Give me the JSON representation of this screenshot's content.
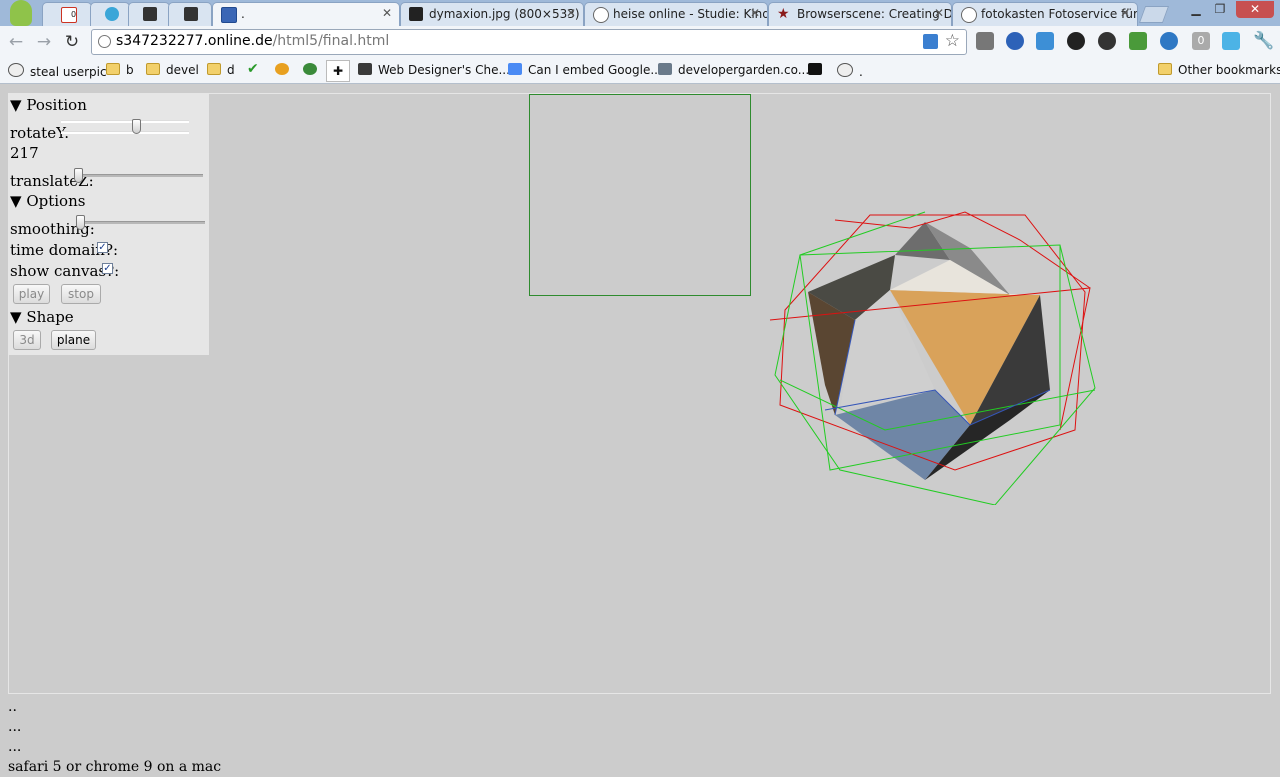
{
  "tabs": [
    {
      "title": "",
      "favicon": "gmail-icon",
      "color": "#cc3322",
      "badge": "0"
    },
    {
      "title": "",
      "favicon": "twitter-icon",
      "color": "#3aa6d8"
    },
    {
      "title": "",
      "favicon": "plus-app-icon",
      "color": "#333333"
    },
    {
      "title": "",
      "favicon": "plus-app-icon",
      "color": "#333333"
    },
    {
      "title": ".",
      "favicon": "page-icon",
      "color": "#3a66b5",
      "active": true
    },
    {
      "title": "dymaxion.jpg (800×533)",
      "favicon": "image-icon",
      "color": "#222222"
    },
    {
      "title": "heise online - Studie: Kind",
      "favicon": "heise-icon",
      "color": "#ffffff"
    },
    {
      "title": "Browserscene: Creating D",
      "favicon": "star-icon",
      "color": "#8a1a1a"
    },
    {
      "title": "fotokasten Fotoservice für",
      "favicon": "globe-icon",
      "color": "#ffffff"
    }
  ],
  "toolbar": {
    "url_host": "s347232277.online.de",
    "url_path": "/html5/final.html",
    "badge_count": "0"
  },
  "bookmarks": [
    {
      "label": "steal userpic",
      "icon": "globe-icon"
    },
    {
      "label": "b",
      "icon": "folder-icon"
    },
    {
      "label": "devel",
      "icon": "folder-icon"
    },
    {
      "label": "d",
      "icon": "folder-icon"
    },
    {
      "label": "",
      "icon": "check-icon"
    },
    {
      "label": "",
      "icon": "smiley-icon"
    },
    {
      "label": "",
      "icon": "ball-icon"
    },
    {
      "label": "",
      "icon": "puzzle-icon"
    },
    {
      "label": "Web Designer's Che...",
      "icon": "checkbox-icon"
    },
    {
      "label": "Can I embed Google...",
      "icon": "google-icon"
    },
    {
      "label": "developergarden.co...",
      "icon": "page-icon"
    },
    {
      "label": "",
      "icon": "hp-icon"
    },
    {
      "label": ".",
      "icon": "globe-icon"
    }
  ],
  "other_bookmarks": "Other bookmarks",
  "panel": {
    "position_heading": "Position",
    "rotate_label": "rotateY:",
    "rotate_value": "217",
    "rotate_fraction": 0.6,
    "translate_label": "translateZ:",
    "translate_fraction": 0.0,
    "options_heading": "Options",
    "smoothing_label": "smoothing:",
    "smoothing_fraction": 0.0,
    "time_domain_label": "time domain?:",
    "time_domain_checked": true,
    "show_canvas_label": "show canvas?:",
    "show_canvas_checked": true,
    "play_label": "play",
    "stop_label": "stop",
    "shape_heading": "Shape",
    "btn_3d_label": "3d",
    "btn_plane_label": "plane"
  },
  "footer": {
    "line1": "..",
    "line2": "...",
    "line3": "...",
    "line4": "safari 5 or chrome 9 on a mac"
  }
}
